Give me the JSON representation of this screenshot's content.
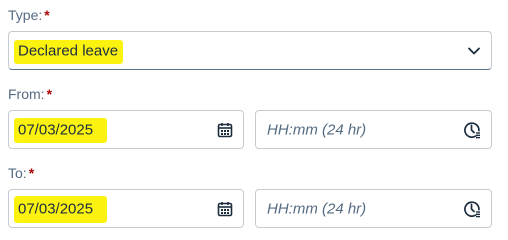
{
  "type": {
    "label": "Type:",
    "required": "*",
    "value": "Declared leave"
  },
  "from": {
    "label": "From:",
    "required": "*",
    "date": "07/03/2025",
    "time_placeholder": "HH:mm (24 hr)"
  },
  "to": {
    "label": "To:",
    "required": "*",
    "date": "07/03/2025",
    "time_placeholder": "HH:mm (24 hr)"
  },
  "icons": {
    "dropdown": "chevron-down-icon",
    "date": "calendar-icon",
    "time": "clock-icon"
  },
  "colors": {
    "highlight": "#fbf20f",
    "required": "#aa0808",
    "label": "#556b82",
    "border": "#c7cbd1"
  }
}
